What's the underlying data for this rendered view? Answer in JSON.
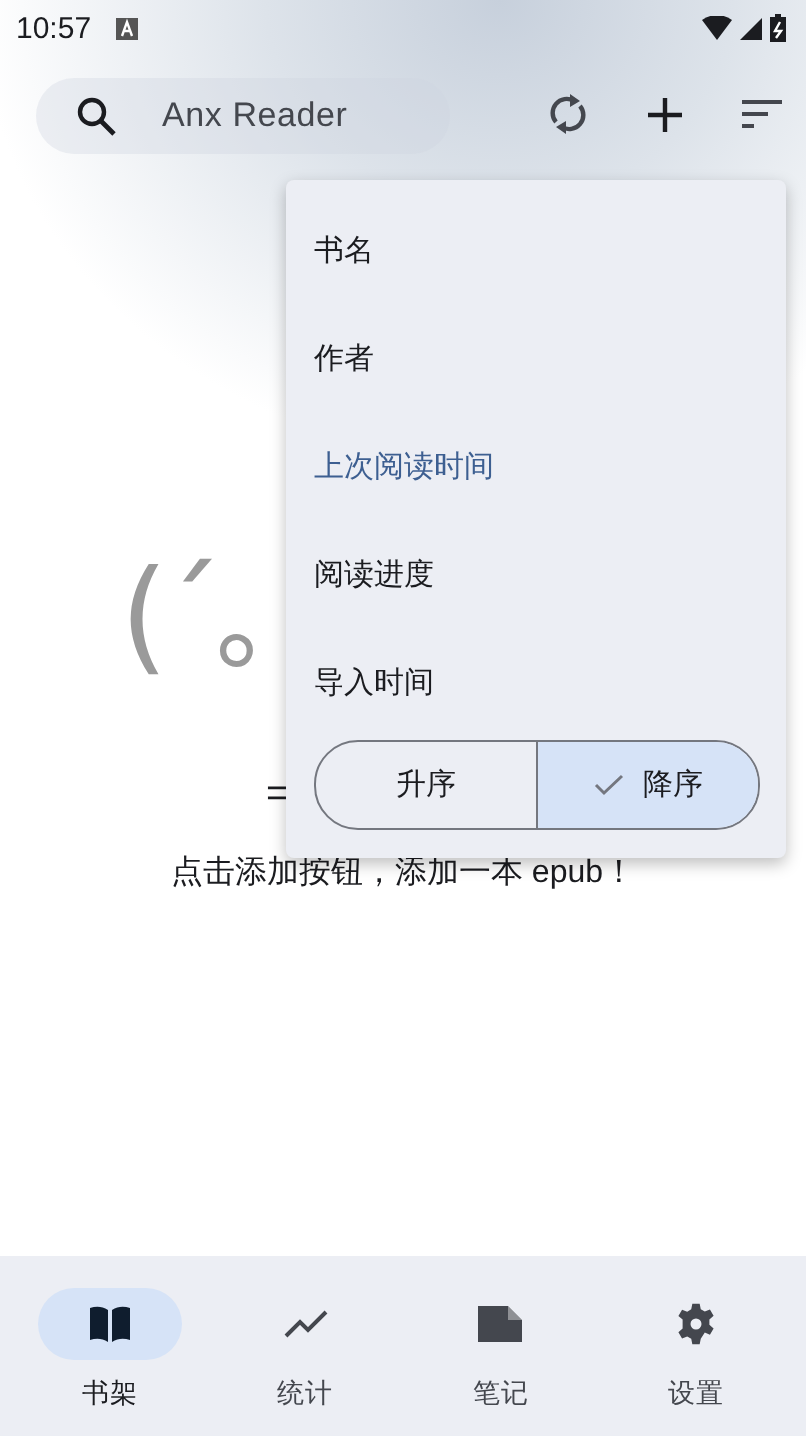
{
  "status_bar": {
    "time": "10:57"
  },
  "search": {
    "placeholder": "Anx Reader"
  },
  "sort_menu": {
    "items": [
      {
        "label": "书名",
        "selected": false
      },
      {
        "label": "作者",
        "selected": false
      },
      {
        "label": "上次阅读时间",
        "selected": true
      },
      {
        "label": "阅读进度",
        "selected": false
      },
      {
        "label": "导入时间",
        "selected": false
      }
    ],
    "order": [
      {
        "label": "升序",
        "selected": false
      },
      {
        "label": "降序",
        "selected": true
      }
    ]
  },
  "empty_state": {
    "face": "(´｡",
    "partial": "=",
    "message": "点击添加按钮，添加一本 epub！"
  },
  "bottom_nav": [
    {
      "label": "书架",
      "selected": true,
      "kind": "book"
    },
    {
      "label": "统计",
      "selected": false,
      "kind": "chart"
    },
    {
      "label": "笔记",
      "selected": false,
      "kind": "note"
    },
    {
      "label": "设置",
      "selected": false,
      "kind": "settings"
    }
  ]
}
